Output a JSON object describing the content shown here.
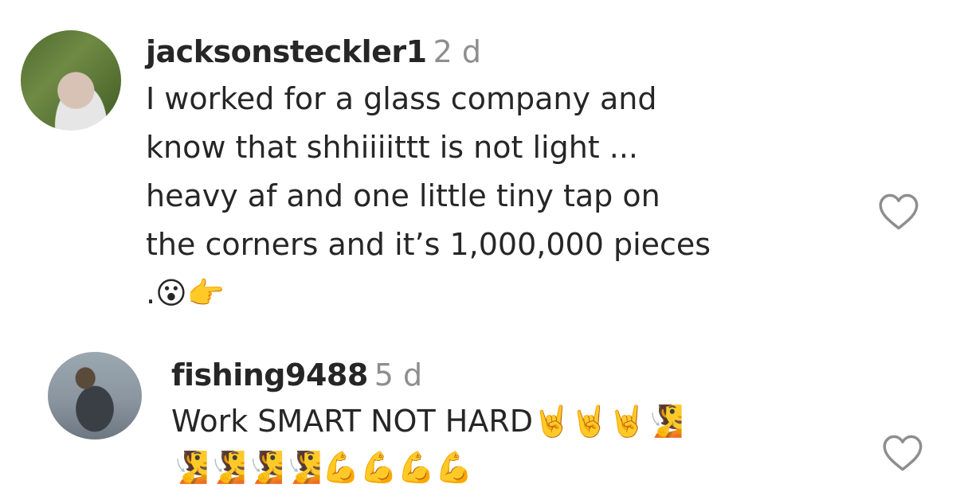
{
  "comments": [
    {
      "username": "jacksonsteckler1",
      "time": "2 d",
      "text": "I worked for a glass company and\nknow that shhiiiittt is not light ...\nheavy af and one little tiny tap on\nthe corners and it’s 1,000,000 pieces\n.😮👉",
      "avatar_icon": "profile-photo-avatar",
      "like_icon": "heart-outline-icon"
    },
    {
      "username": "fishing9488",
      "time": "5 d",
      "text": "Work SMART NOT HARD🤘🤘🤘🧏\n🧏🧏🧏🧏💪💪💪💪",
      "avatar_icon": "profile-photo-avatar",
      "like_icon": "heart-outline-icon"
    }
  ],
  "colors": {
    "text": "#262626",
    "secondary": "#8e8e8e",
    "background": "#ffffff"
  }
}
